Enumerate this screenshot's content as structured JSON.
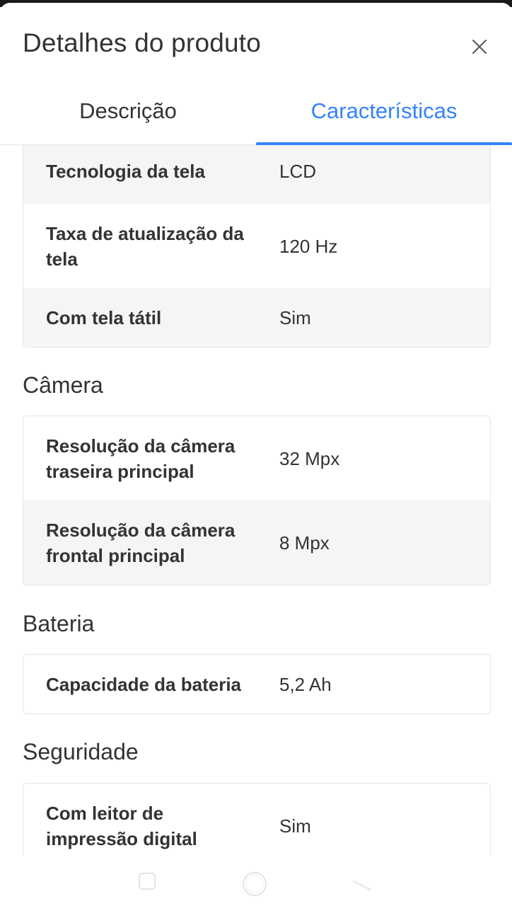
{
  "header": {
    "title": "Detalhes do produto",
    "close_icon": "close-icon"
  },
  "tabs": [
    {
      "label": "Descrição",
      "active": false
    },
    {
      "label": "Características",
      "active": true
    }
  ],
  "colors": {
    "accent": "#3483fa",
    "text": "#333333",
    "row_shade": "#f5f5f5",
    "border": "#e6e6e6"
  },
  "sections": {
    "tela": {
      "rows": [
        {
          "label": "Tecnologia da tela",
          "value": "LCD"
        },
        {
          "label": "Taxa de atualização da tela",
          "value": "120 Hz"
        },
        {
          "label": "Com tela tátil",
          "value": "Sim"
        }
      ]
    },
    "camera": {
      "title": "Câmera",
      "rows": [
        {
          "label": "Resolução da câmera traseira principal",
          "value": "32 Mpx"
        },
        {
          "label": "Resolução da câmera frontal principal",
          "value": "8 Mpx"
        }
      ]
    },
    "bateria": {
      "title": "Bateria",
      "rows": [
        {
          "label": "Capacidade da bateria",
          "value": "5,2 Ah"
        }
      ]
    },
    "seguranca": {
      "title": "Seguridade",
      "rows": [
        {
          "label": "Com leitor de impressão digital",
          "value": "Sim"
        }
      ]
    }
  },
  "system_nav": {
    "icons": [
      "recent-apps-icon",
      "home-icon",
      "back-icon"
    ]
  }
}
